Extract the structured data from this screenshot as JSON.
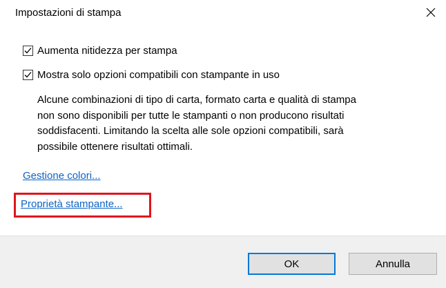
{
  "window": {
    "title": "Impostazioni di stampa"
  },
  "options": {
    "sharpen": {
      "label": "Aumenta nitidezza per stampa",
      "checked": true
    },
    "compatible_only": {
      "label": "Mostra solo opzioni compatibili con stampante in uso",
      "checked": true,
      "description": [
        "Alcune combinazioni di tipo di carta, formato carta e qualità di stampa",
        "non sono disponibili per tutte le stampanti o non producono risultati",
        "soddisfacenti. Limitando la scelta alle sole opzioni compatibili, sarà",
        "possibile ottenere risultati ottimali."
      ]
    }
  },
  "links": {
    "color_management": "Gestione colori...",
    "printer_properties": "Proprietà stampante..."
  },
  "buttons": {
    "ok": "OK",
    "cancel": "Annulla"
  },
  "colors": {
    "link": "#0b63c5",
    "highlight": "#e0141e",
    "primary_border": "#0078d7"
  },
  "icons": {
    "close": "close-icon",
    "check": "checkmark-icon"
  }
}
